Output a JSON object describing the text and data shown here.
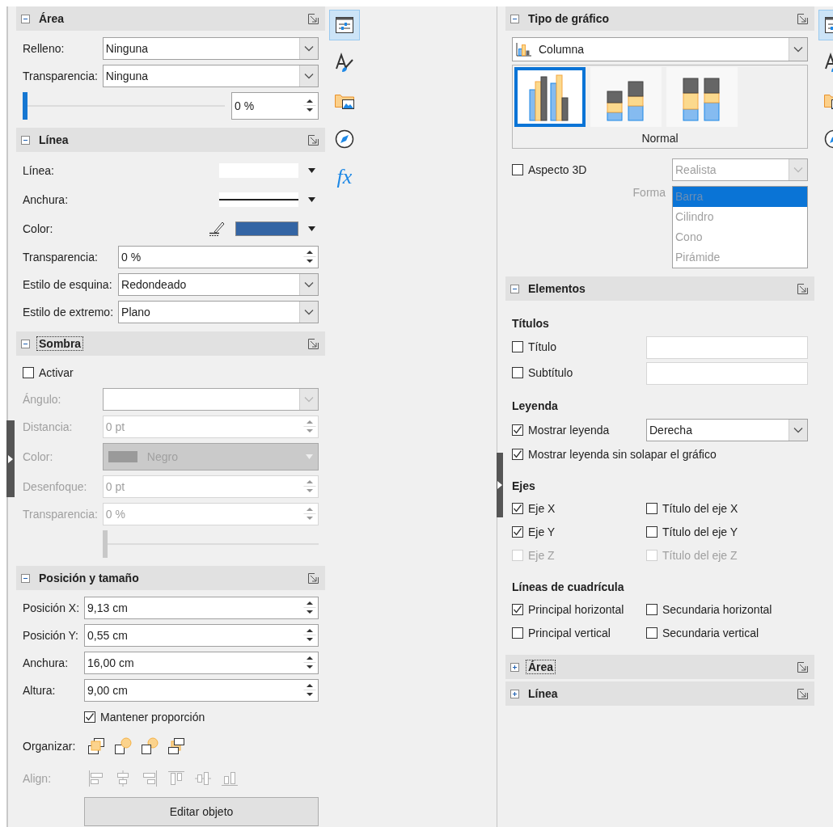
{
  "properties_panel": {
    "sections": [
      {
        "title": "Área",
        "expanded": true,
        "focused": false,
        "rows": [
          {
            "kind": "dropdown",
            "label": "Relleno:",
            "value": "Ninguna",
            "disabled": false
          },
          {
            "kind": "dropdown",
            "label": "Transparencia:",
            "value": "Ninguna",
            "disabled": false
          },
          {
            "kind": "slider_spin",
            "level": 0,
            "value": "0 %",
            "disabled": false
          }
        ]
      },
      {
        "title": "Línea",
        "expanded": true,
        "focused": false,
        "rows": [
          {
            "kind": "line_style",
            "label": "Línea:",
            "disabled": false
          },
          {
            "kind": "line_width",
            "label": "Anchura:",
            "disabled": false
          },
          {
            "kind": "line_color",
            "label": "Color:",
            "color": "#3465a4",
            "disabled": false
          },
          {
            "kind": "spin",
            "label": "Transparencia:",
            "value": "0 %",
            "disabled": false
          },
          {
            "kind": "dropdown",
            "label": "Estilo de esquina:",
            "value": "Redondeado",
            "disabled": false
          },
          {
            "kind": "dropdown",
            "label": "Estilo de extremo:",
            "value": "Plano",
            "disabled": false
          }
        ]
      },
      {
        "title": "Sombra",
        "expanded": true,
        "focused": true,
        "rows": [
          {
            "kind": "checkbox",
            "label": "Activar",
            "checked": false,
            "disabled": false
          },
          {
            "kind": "dropdown",
            "label": "Ángulo:",
            "disabled": true
          },
          {
            "kind": "spin",
            "label": "Distancia:",
            "value": "0 pt",
            "disabled": true
          },
          {
            "kind": "color_dropdown",
            "label": "Color:",
            "value": "Negro",
            "disabled": true
          },
          {
            "kind": "spin",
            "label": "Desenfoque:",
            "value": "0 pt",
            "disabled": true
          },
          {
            "kind": "spin",
            "label": "Transparencia:",
            "value": "0 %",
            "disabled": true
          },
          {
            "kind": "slider",
            "level": 0,
            "disabled": true
          }
        ]
      },
      {
        "title": "Posición y tamaño",
        "expanded": true,
        "focused": false,
        "rows": [
          {
            "kind": "spin",
            "label": "Posición X:",
            "value": "9,13 cm",
            "disabled": false
          },
          {
            "kind": "spin",
            "label": "Posición Y:",
            "value": "0,55 cm",
            "disabled": false
          },
          {
            "kind": "spin",
            "label": "Anchura:",
            "value": "16,00 cm",
            "disabled": false
          },
          {
            "kind": "spin",
            "label": "Altura:",
            "value": "9,00 cm",
            "disabled": false
          },
          {
            "kind": "field_checkbox",
            "label": "Mantener proporción",
            "checked": true,
            "disabled": false
          },
          {
            "kind": "tools",
            "label": "Organizar:",
            "disabled": false,
            "tools": [
              {
                "kind": "front"
              },
              {
                "kind": "forward"
              },
              {
                "kind": "backward"
              },
              {
                "kind": "back"
              }
            ]
          },
          {
            "kind": "tools",
            "label": "Align:",
            "disabled": true,
            "tools": [
              {
                "kind": "left"
              },
              {
                "kind": "center"
              },
              {
                "kind": "right"
              },
              {
                "kind": "top"
              },
              {
                "kind": "middle"
              },
              {
                "kind": "bottom"
              }
            ]
          },
          {
            "kind": "button",
            "label": "Editar objeto",
            "disabled": false
          }
        ]
      }
    ],
    "tabs": [
      {
        "kind": "properties",
        "selected": true
      },
      {
        "kind": "styles",
        "selected": false
      },
      {
        "kind": "gallery",
        "selected": false
      },
      {
        "kind": "navigator",
        "selected": false
      },
      {
        "kind": "functions",
        "glyph": "fx",
        "selected": false
      }
    ]
  },
  "chart_panel": {
    "sections": [
      {
        "kind": "chart_type",
        "title": "Tipo de gráfico",
        "expanded": true,
        "focused": false,
        "chart_type": "Columna",
        "variants": [
          {
            "kind": "normal",
            "selected": true
          },
          {
            "kind": "stacked",
            "selected": false
          },
          {
            "kind": "percent",
            "selected": false
          }
        ],
        "variant_caption": "Normal",
        "three_d": {
          "label": "Aspecto 3D",
          "checked": false,
          "disabled": false
        },
        "scheme": {
          "value": "Realista",
          "disabled": true
        },
        "shape": {
          "label": "Forma",
          "disabled": true,
          "options": [
            {
              "label": "Barra",
              "selected": true
            },
            {
              "label": "Cilindro",
              "selected": false
            },
            {
              "label": "Cono",
              "selected": false
            },
            {
              "label": "Pirámide",
              "selected": false
            }
          ]
        }
      },
      {
        "kind": "elements",
        "title": "Elementos",
        "expanded": true,
        "focused": false,
        "groups": [
          {
            "title": "Títulos",
            "rows": [
              {
                "cells": [
                  {
                    "kind": "checkbox",
                    "label": "Título",
                    "checked": false,
                    "disabled": false
                  },
                  {
                    "kind": "text_field"
                  }
                ]
              },
              {
                "cells": [
                  {
                    "kind": "checkbox",
                    "label": "Subtítulo",
                    "checked": false,
                    "disabled": false
                  },
                  {
                    "kind": "text_field"
                  }
                ]
              }
            ]
          },
          {
            "title": "Leyenda",
            "rows": [
              {
                "cells": [
                  {
                    "kind": "checkbox",
                    "label": "Mostrar leyenda",
                    "checked": true,
                    "disabled": false
                  },
                  {
                    "kind": "dropdown",
                    "value": "Derecha"
                  }
                ]
              },
              {
                "cells": [
                  {
                    "kind": "checkbox",
                    "label": "Mostrar leyenda sin solapar el gráfico",
                    "checked": true,
                    "disabled": false
                  }
                ]
              }
            ]
          },
          {
            "title": "Ejes",
            "rows": [
              {
                "cells": [
                  {
                    "kind": "checkbox",
                    "label": "Eje X",
                    "checked": true,
                    "disabled": false
                  },
                  {
                    "kind": "checkbox",
                    "label": "Título del eje X",
                    "checked": false,
                    "disabled": false
                  }
                ]
              },
              {
                "cells": [
                  {
                    "kind": "checkbox",
                    "label": "Eje Y",
                    "checked": true,
                    "disabled": false
                  },
                  {
                    "kind": "checkbox",
                    "label": "Título del eje Y",
                    "checked": false,
                    "disabled": false
                  }
                ]
              },
              {
                "cells": [
                  {
                    "kind": "checkbox",
                    "label": "Eje Z",
                    "checked": false,
                    "disabled": true
                  },
                  {
                    "kind": "checkbox",
                    "label": "Título del eje Z",
                    "checked": false,
                    "disabled": true
                  }
                ]
              }
            ]
          },
          {
            "title": "Líneas de cuadrícula",
            "rows": [
              {
                "cells": [
                  {
                    "kind": "checkbox",
                    "label": "Principal horizontal",
                    "checked": true,
                    "disabled": false
                  },
                  {
                    "kind": "checkbox",
                    "label": "Secundaria horizontal",
                    "checked": false,
                    "disabled": false
                  }
                ]
              },
              {
                "cells": [
                  {
                    "kind": "checkbox",
                    "label": "Principal vertical",
                    "checked": false,
                    "disabled": false
                  },
                  {
                    "kind": "checkbox",
                    "label": "Secundaria vertical",
                    "checked": false,
                    "disabled": false
                  }
                ]
              }
            ]
          }
        ]
      },
      {
        "kind": "plain",
        "title": "Área",
        "expanded": false,
        "focused": true
      },
      {
        "kind": "plain",
        "title": "Línea",
        "expanded": false,
        "focused": false
      }
    ],
    "tabs": [
      {
        "kind": "properties",
        "selected": true
      },
      {
        "kind": "styles",
        "selected": false
      },
      {
        "kind": "gallery",
        "selected": false
      },
      {
        "kind": "navigator",
        "selected": false
      }
    ]
  }
}
